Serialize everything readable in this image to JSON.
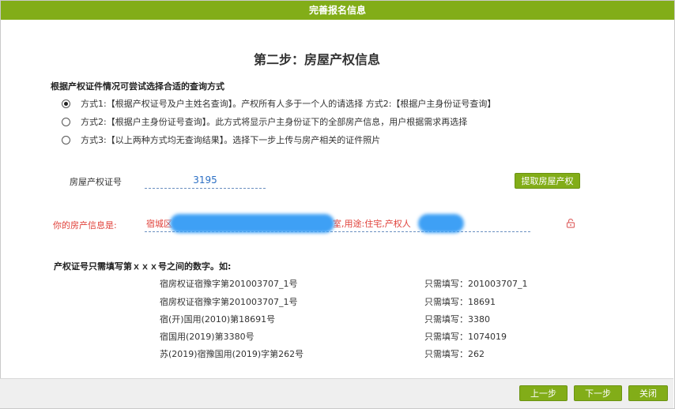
{
  "window": {
    "title": "完善报名信息"
  },
  "step_title": "第二步：房屋产权信息",
  "query_hint": "根据产权证件情况可尝试选择合适的查询方式",
  "options": [
    {
      "label": "方式1:【根据产权证号及户主姓名查询】。产权所有人多于一个人的请选择 方式2:【根据户主身份证号查询】",
      "selected": true
    },
    {
      "label": "方式2:【根据户主身份证号查询】。此方式将显示户主身份证下的全部房产信息，用户根据需求再选择",
      "selected": false
    },
    {
      "label": "方式3:【以上两种方式均无查询结果】。选择下一步上传与房产相关的证件照片",
      "selected": false
    }
  ],
  "cert_field": {
    "label": "房屋产权证号",
    "value": "3195"
  },
  "fetch_button": "提取房屋产权",
  "property_info": {
    "label": "你的房产信息是:",
    "prefix": "宿城区",
    "middle": "室,用途:住宅,产权人"
  },
  "example_title": "产权证号只需填写第ｘｘｘ号之间的数字。如:",
  "examples": [
    {
      "cert": "宿房权证宿豫字第201003707_1号",
      "fill": "只需填写：201003707_1"
    },
    {
      "cert": "宿房权证宿豫字第201003707_1号",
      "fill": "只需填写：18691"
    },
    {
      "cert": "宿(开)国用(2010)第18691号",
      "fill": "只需填写：3380"
    },
    {
      "cert": "宿国用(2019)第3380号",
      "fill": "只需填写：1074019"
    },
    {
      "cert": "苏(2019)宿豫国用(2019)字第262号",
      "fill": "只需填写：262"
    }
  ],
  "footer": {
    "prev": "上一步",
    "next": "下一步",
    "close": "关闭"
  },
  "colors": {
    "accent": "#82ad18",
    "error_text": "#e0413a",
    "value_blue": "#2b6fc4"
  }
}
